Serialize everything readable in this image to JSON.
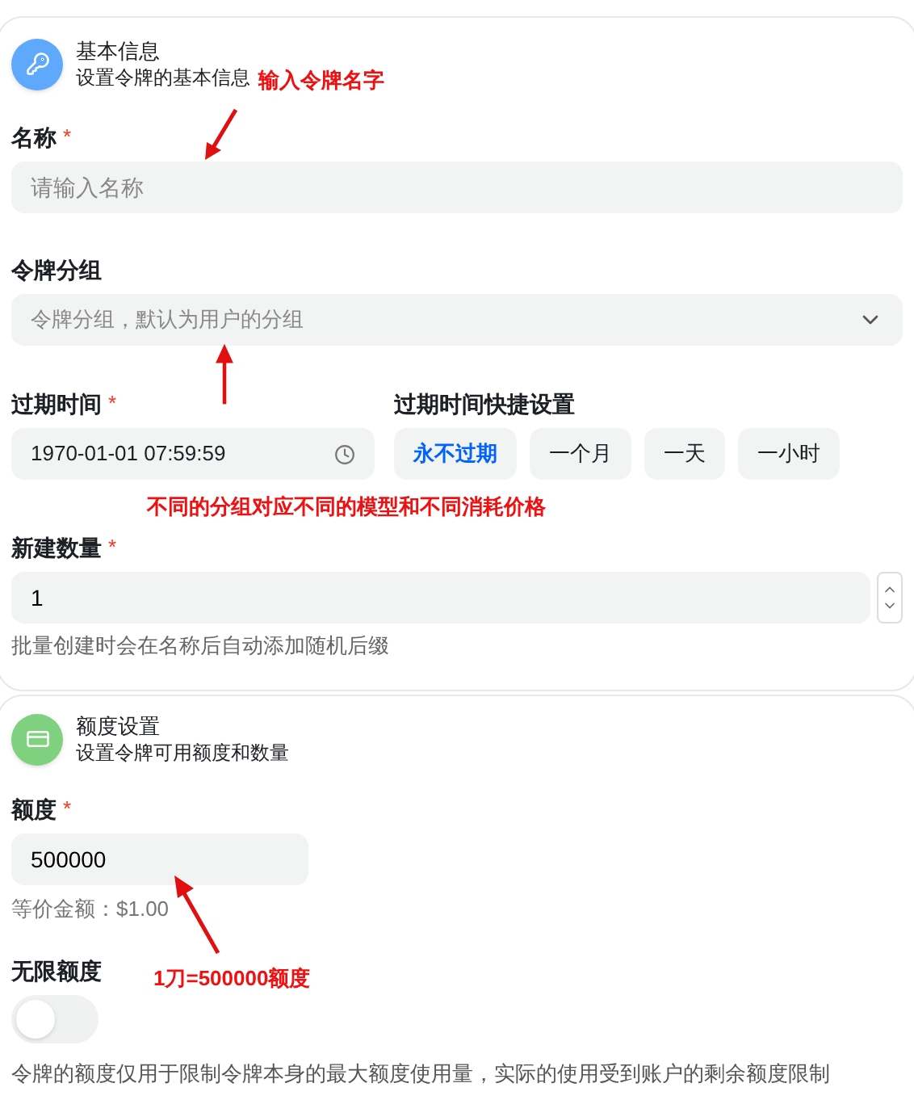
{
  "basic": {
    "title": "基本信息",
    "subtitle": "设置令牌的基本信息",
    "name": {
      "label": "名称",
      "required_mark": "*",
      "placeholder": "请输入名称"
    },
    "group": {
      "label": "令牌分组",
      "placeholder": "令牌分组，默认为用户的分组"
    },
    "expiry": {
      "label": "过期时间",
      "required_mark": "*",
      "value": "1970-01-01 07:59:59"
    },
    "quick": {
      "label": "过期时间快捷设置",
      "buttons": [
        {
          "label": "永不过期",
          "selected": true
        },
        {
          "label": "一个月",
          "selected": false
        },
        {
          "label": "一天",
          "selected": false
        },
        {
          "label": "一小时",
          "selected": false
        }
      ]
    },
    "count": {
      "label": "新建数量",
      "required_mark": "*",
      "value": "1",
      "hint": "批量创建时会在名称后自动添加随机后缀"
    }
  },
  "quota": {
    "title": "额度设置",
    "subtitle": "设置令牌可用额度和数量",
    "amount": {
      "label": "额度",
      "required_mark": "*",
      "value": "500000",
      "hint": "等价金额：$1.00"
    },
    "unlimited": {
      "label": "无限额度",
      "on": false,
      "note": "令牌的额度仅用于限制令牌本身的最大额度使用量，实际的使用受到账户的剩余额度限制"
    }
  },
  "annotations": [
    {
      "text": "输入令牌名字"
    },
    {
      "text": "不同的分组对应不同的模型和不同消耗价格"
    },
    {
      "text": "1刀=500000额度"
    }
  ]
}
